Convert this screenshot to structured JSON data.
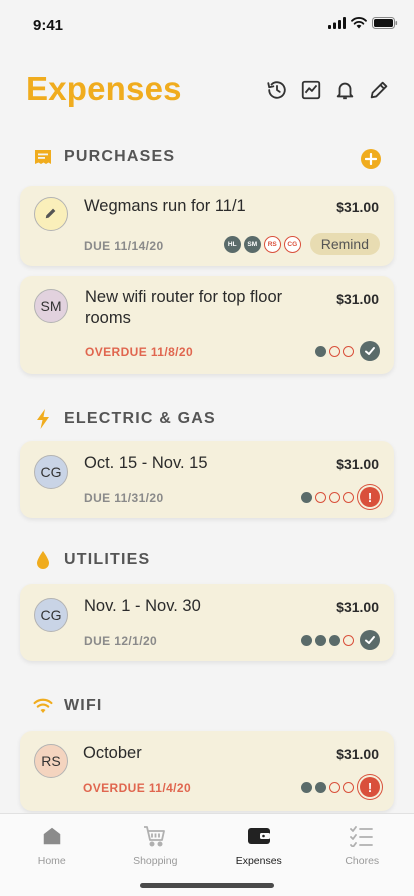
{
  "status_bar": {
    "time": "9:41"
  },
  "header": {
    "title": "Expenses",
    "actions": [
      "history-icon",
      "chart-icon",
      "bell-icon",
      "pencil-icon"
    ]
  },
  "colors": {
    "accent": "#f0ac1e",
    "card": "#f5f0dc",
    "paid": "#5a6b6a",
    "overdue": "#d9503b"
  },
  "sections": {
    "purchases": {
      "label": "PURCHASES",
      "items": [
        {
          "title": "Wegmans run for 11/1",
          "amount": "$31.00",
          "due": "DUE 11/14/20",
          "avatar_icon": "pencil-icon",
          "participants": [
            "HL",
            "SM",
            "RS",
            "CG"
          ],
          "remind_label": "Remind"
        },
        {
          "avatar": "SM",
          "title": "New wifi router for top floor rooms",
          "amount": "$31.00",
          "due": "OVERDUE 11/8/20"
        }
      ]
    },
    "electric_gas": {
      "label": "ELECTRIC & GAS",
      "items": [
        {
          "avatar": "CG",
          "title": "Oct. 15 - Nov. 15",
          "amount": "$31.00",
          "due": "DUE 11/31/20"
        }
      ]
    },
    "utilities": {
      "label": "UTILITIES",
      "items": [
        {
          "avatar": "CG",
          "title": "Nov. 1 - Nov. 30",
          "amount": "$31.00",
          "due": "DUE 12/1/20"
        }
      ]
    },
    "wifi": {
      "label": "WIFI",
      "items": [
        {
          "avatar": "RS",
          "title": "October",
          "amount": "$31.00",
          "due": "OVERDUE 11/4/20"
        }
      ]
    }
  },
  "tabs": [
    {
      "label": "Home",
      "icon": "home-icon"
    },
    {
      "label": "Shopping",
      "icon": "cart-icon"
    },
    {
      "label": "Expenses",
      "icon": "wallet-icon",
      "active": true
    },
    {
      "label": "Chores",
      "icon": "checklist-icon"
    }
  ]
}
